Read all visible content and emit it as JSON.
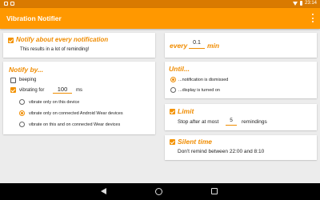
{
  "status_bar": {
    "time": "23:14"
  },
  "app": {
    "title": "Vibration Notifier"
  },
  "notify_every": {
    "title": "Notify about every notification",
    "subtitle": "This results in a lot of reminding!",
    "checked": true
  },
  "notify_by": {
    "title": "Notify by...",
    "beeping_label": "beeping",
    "beeping_checked": false,
    "vibrating_label": "vibrating for",
    "vibrating_checked": true,
    "vibrating_value": "100",
    "vibrating_unit": "ms",
    "options": [
      {
        "label": "vibrate only on this device",
        "selected": false
      },
      {
        "label": "vibrate only on connected Android Wear devices",
        "selected": true
      },
      {
        "label": "vibrate on this and on connected Wear devices",
        "selected": false
      }
    ]
  },
  "every": {
    "prefix": "every",
    "value": "0.1",
    "unit": "min"
  },
  "until": {
    "title": "Until...",
    "options": [
      {
        "label": "...notification is dismissed",
        "selected": true
      },
      {
        "label": "...display is turned on",
        "selected": false
      }
    ]
  },
  "limit": {
    "title": "Limit",
    "checked": true,
    "prefix": "Stop after at most",
    "value": "5",
    "suffix": "remindings"
  },
  "silent_time": {
    "title": "Silent time",
    "checked": true,
    "text": "Don't remind between 22:00 and 8:10"
  },
  "colors": {
    "accent": "#ff9800",
    "status_bar": "#d97a00",
    "heading": "#f08c00"
  }
}
